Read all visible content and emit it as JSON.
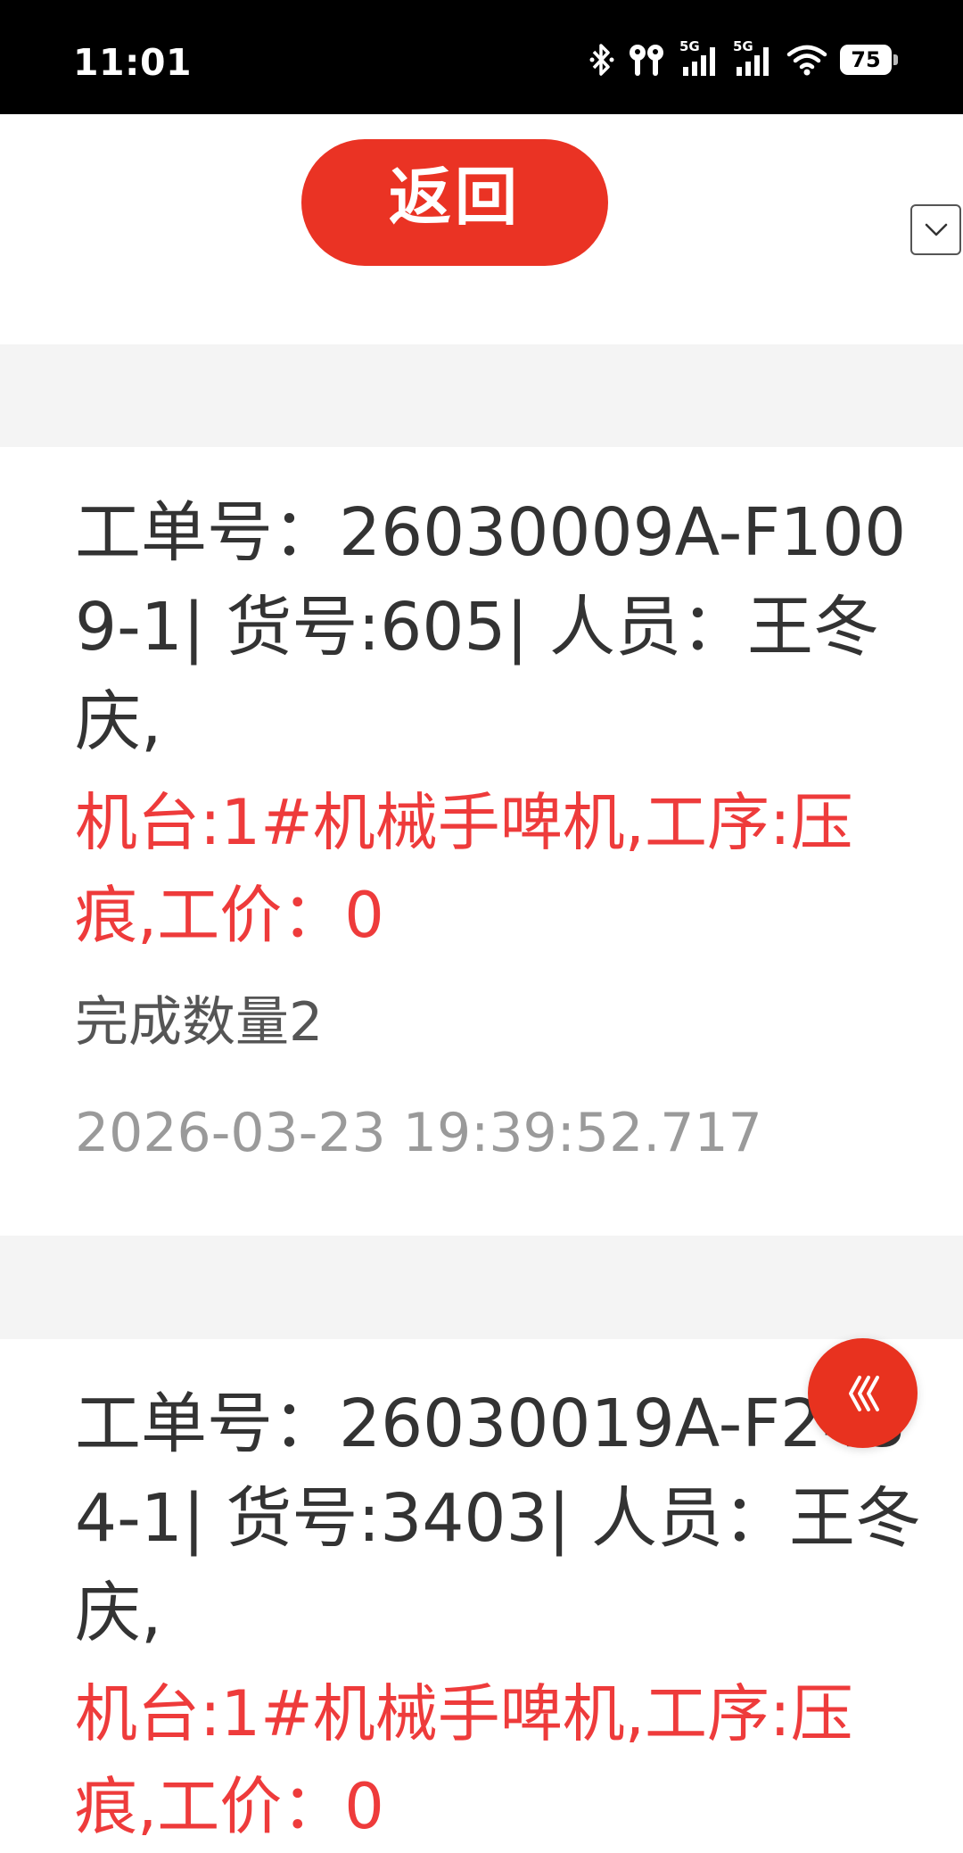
{
  "status_bar": {
    "time": "11:01",
    "battery": "75",
    "icons": [
      "bluetooth-icon",
      "earbuds-icon",
      "signal-5g-icon",
      "signal-5g-icon",
      "wifi-icon",
      "battery-icon"
    ],
    "signal_labels": [
      "5G",
      "5G"
    ]
  },
  "header": {
    "back_label": "返回",
    "dropdown_icon": "chevron-down-icon"
  },
  "records": [
    {
      "title": "工单号：26030009A-F1009-1| 货号:605| 人员：王冬庆,",
      "machine": "机台:1#机械手啤机,工序:压痕,工价：0",
      "quantity": "完成数量2",
      "time": "2026-03-23 19:39:52.717"
    },
    {
      "title": "工单号：26030019A-F2434-1| 货号:3403| 人员：王冬庆,",
      "machine": "机台:1#机械手啤机,工序:压痕,工价：0"
    }
  ],
  "fab": {
    "icon": "triple-chevron-left-icon"
  },
  "colors": {
    "accent": "#ea3324",
    "machine_text": "#ee3b3b",
    "separator": "#f4f4f4",
    "status_bar": "#000000"
  }
}
